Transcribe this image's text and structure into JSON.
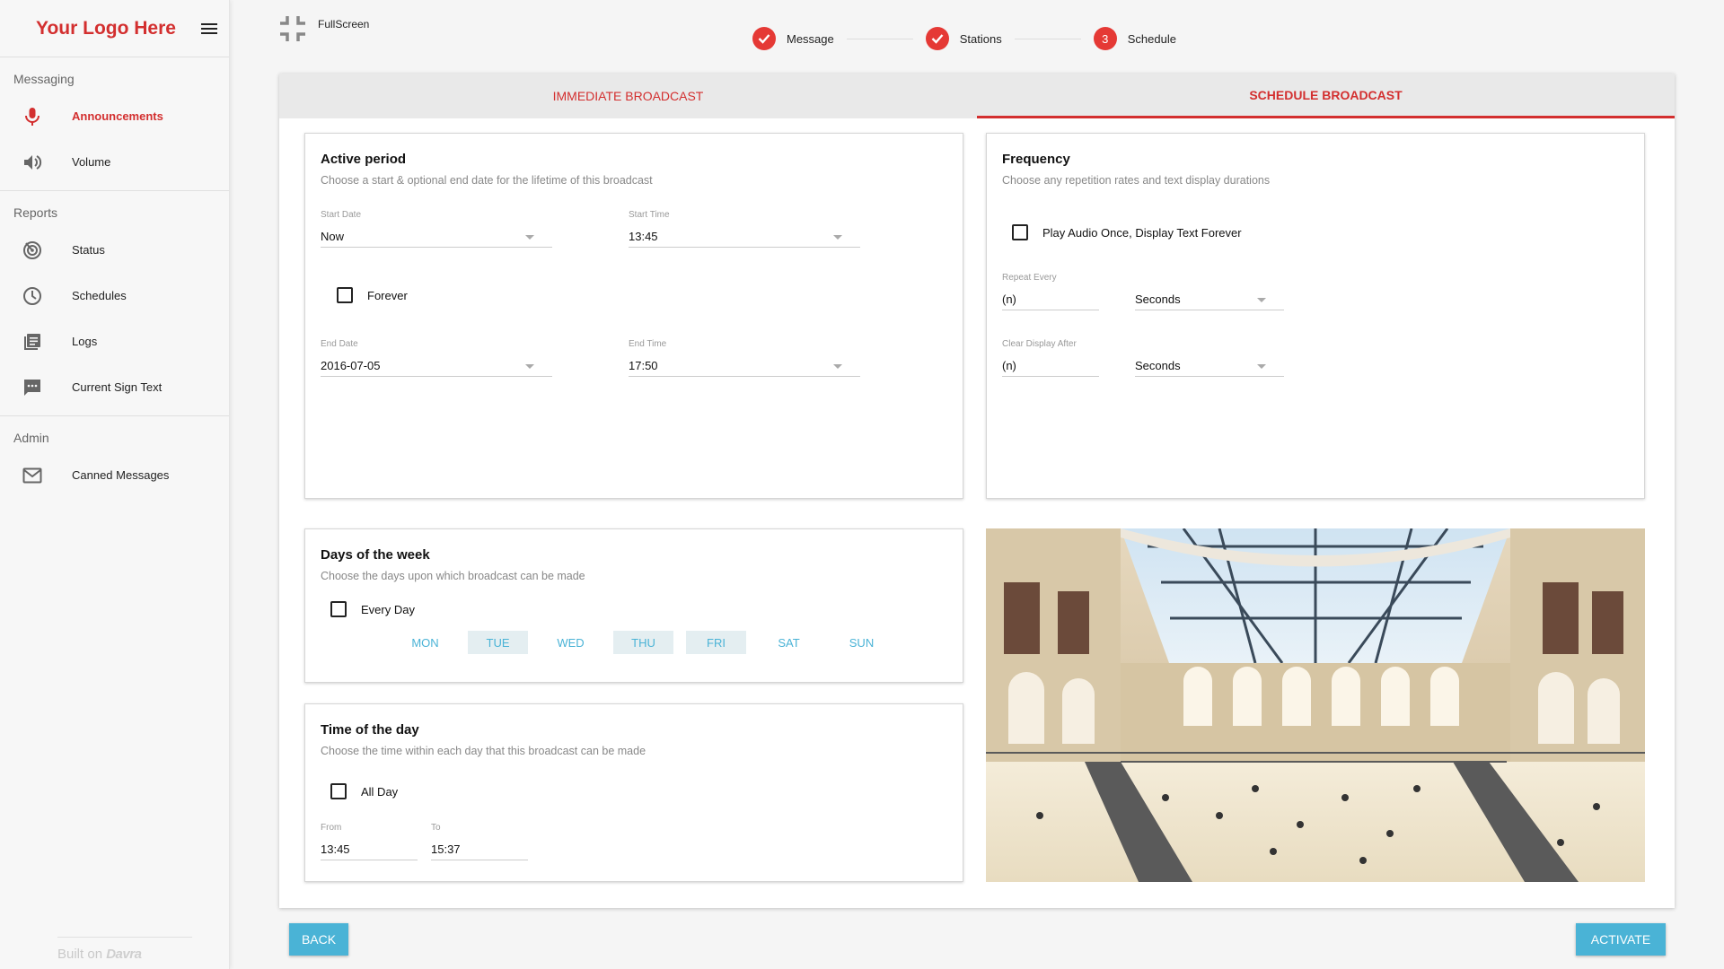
{
  "app": {
    "logo": "Your Logo Here"
  },
  "sidebar": {
    "sections": [
      {
        "label": "Messaging",
        "items": [
          {
            "label": "Announcements",
            "icon": "microphone-icon",
            "active": true
          },
          {
            "label": "Volume",
            "icon": "volume-icon"
          }
        ]
      },
      {
        "label": "Reports",
        "items": [
          {
            "label": "Status",
            "icon": "radar-icon"
          },
          {
            "label": "Schedules",
            "icon": "clock-icon"
          },
          {
            "label": "Logs",
            "icon": "logs-icon"
          },
          {
            "label": "Current Sign Text",
            "icon": "chat-icon"
          }
        ]
      },
      {
        "label": "Admin",
        "items": [
          {
            "label": "Canned Messages",
            "icon": "mail-icon"
          }
        ]
      }
    ],
    "built_on_prefix": "Built on",
    "built_on_brand": "Davra"
  },
  "topbar": {
    "fullscreen_label": "FullScreen"
  },
  "stepper": {
    "steps": [
      {
        "label": "Message",
        "state": "done"
      },
      {
        "label": "Stations",
        "state": "done"
      },
      {
        "label": "Schedule",
        "state": "current",
        "number": "3"
      }
    ]
  },
  "tabs": {
    "immediate": "IMMEDIATE BROADCAST",
    "schedule": "SCHEDULE BROADCAST"
  },
  "active_period": {
    "title": "Active period",
    "subtitle": "Choose a start & optional end date for the lifetime of this broadcast",
    "start_date_label": "Start Date",
    "start_date": "Now",
    "start_time_label": "Start Time",
    "start_time": "13:45",
    "forever_label": "Forever",
    "end_date_label": "End Date",
    "end_date": "2016-07-05",
    "end_time_label": "End Time",
    "end_time": "17:50"
  },
  "frequency": {
    "title": "Frequency",
    "subtitle": "Choose any repetition rates and text display durations",
    "play_once_label": "Play Audio Once, Display Text Forever",
    "repeat_label": "Repeat Every",
    "repeat_value": "(n)",
    "repeat_unit": "Seconds",
    "clear_label": "Clear Display After",
    "clear_value": "(n)",
    "clear_unit": "Seconds"
  },
  "days": {
    "title": "Days of the week",
    "subtitle": "Choose the days upon which broadcast can be made",
    "every_day_label": "Every Day",
    "list": [
      "MON",
      "TUE",
      "WED",
      "THU",
      "FRI",
      "SAT",
      "SUN"
    ],
    "selected": [
      "TUE",
      "THU",
      "FRI"
    ]
  },
  "time_of_day": {
    "title": "Time of the day",
    "subtitle": "Choose the time within each day that this broadcast can be made",
    "all_day_label": "All Day",
    "from_label": "From",
    "from_value": "13:45",
    "to_label": "To",
    "to_value": "15:37"
  },
  "buttons": {
    "back": "BACK",
    "activate": "ACTIVATE"
  },
  "colors": {
    "accent": "#d32f2f",
    "button": "#4ab3d6",
    "step": "#e53935"
  }
}
